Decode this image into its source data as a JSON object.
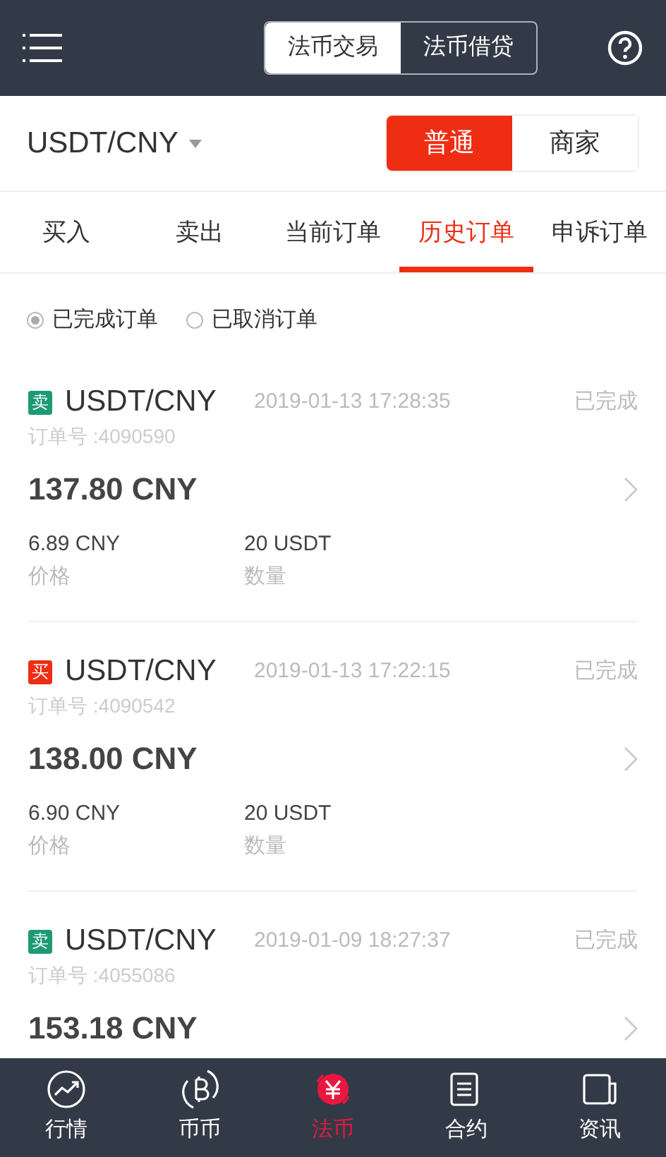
{
  "header": {
    "segments": [
      {
        "label": "法币交易",
        "selected": true
      },
      {
        "label": "法币借贷",
        "selected": false
      }
    ]
  },
  "market": {
    "pair": "USDT/CNY",
    "modes": [
      {
        "label": "普通",
        "selected": true
      },
      {
        "label": "商家",
        "selected": false
      }
    ]
  },
  "tabs": [
    {
      "label": "买入",
      "selected": false
    },
    {
      "label": "卖出",
      "selected": false
    },
    {
      "label": "当前订单",
      "selected": false
    },
    {
      "label": "历史订单",
      "selected": true
    },
    {
      "label": "申诉订单",
      "selected": false
    }
  ],
  "filters": [
    {
      "label": "已完成订单",
      "selected": true
    },
    {
      "label": "已取消订单",
      "selected": false
    }
  ],
  "orders": [
    {
      "kind": "sell",
      "badge": "卖",
      "pair": "USDT/CNY",
      "time": "2019-01-13 17:28:35",
      "status": "已完成",
      "order_no": "订单号 :4090590",
      "total": "137.80 CNY",
      "price": "6.89 CNY",
      "price_label": "价格",
      "amount": "20 USDT",
      "amount_label": "数量"
    },
    {
      "kind": "buy",
      "badge": "买",
      "pair": "USDT/CNY",
      "time": "2019-01-13 17:22:15",
      "status": "已完成",
      "order_no": "订单号 :4090542",
      "total": "138.00 CNY",
      "price": "6.90 CNY",
      "price_label": "价格",
      "amount": "20 USDT",
      "amount_label": "数量"
    },
    {
      "kind": "sell",
      "badge": "卖",
      "pair": "USDT/CNY",
      "time": "2019-01-09 18:27:37",
      "status": "已完成",
      "order_no": "订单号 :4055086",
      "total": "153.18 CNY"
    }
  ],
  "bottom_nav": [
    {
      "kind": "chart",
      "label": "行情",
      "selected": false
    },
    {
      "kind": "coin",
      "label": "币币",
      "selected": false
    },
    {
      "kind": "fiat",
      "label": "法币",
      "selected": true
    },
    {
      "kind": "doc",
      "label": "合约",
      "selected": false
    },
    {
      "kind": "news",
      "label": "资讯",
      "selected": false
    }
  ]
}
